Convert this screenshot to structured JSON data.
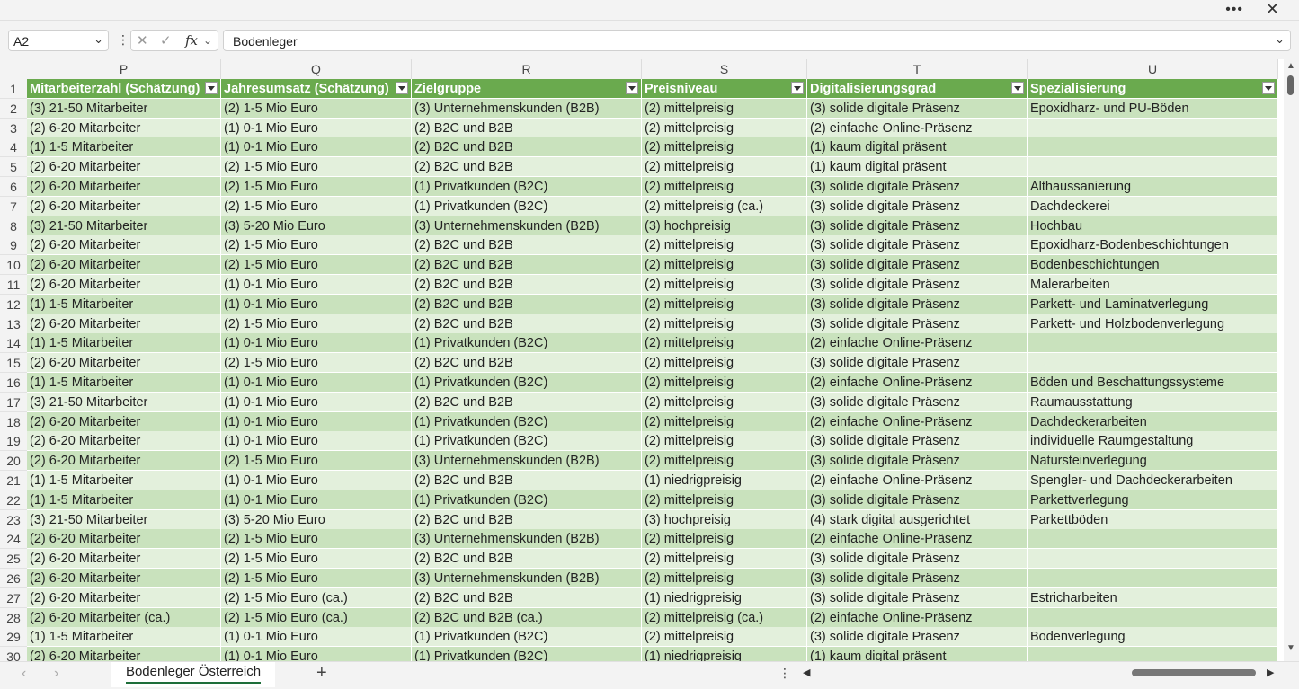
{
  "window": {
    "more_label": "•••",
    "close_label": "✕"
  },
  "formula_bar": {
    "name_box": "A2",
    "formula": "Bodenleger",
    "fx_label": "fx",
    "cancel_label": "✕",
    "enter_label": "✓"
  },
  "columns": [
    {
      "letter": "P",
      "header": "Mitarbeiterzahl (Schätzung)"
    },
    {
      "letter": "Q",
      "header": "Jahresumsatz (Schätzung)"
    },
    {
      "letter": "R",
      "header": "Zielgruppe"
    },
    {
      "letter": "S",
      "header": "Preisniveau"
    },
    {
      "letter": "T",
      "header": "Digitalisierungsgrad"
    },
    {
      "letter": "U",
      "header": "Spezialisierung"
    }
  ],
  "rows": [
    {
      "n": "2",
      "c": [
        "(3) 21-50 Mitarbeiter",
        "(2) 1-5 Mio Euro",
        "(3) Unternehmenskunden (B2B)",
        "(2) mittelpreisig",
        "(3) solide digitale Präsenz",
        "Epoxidharz- und PU-Böden"
      ]
    },
    {
      "n": "3",
      "c": [
        "(2) 6-20 Mitarbeiter",
        "(1) 0-1 Mio Euro",
        "(2) B2C und B2B",
        "(2) mittelpreisig",
        "(2) einfache Online-Präsenz",
        ""
      ]
    },
    {
      "n": "4",
      "c": [
        "(1) 1-5 Mitarbeiter",
        "(1) 0-1 Mio Euro",
        "(2) B2C und B2B",
        "(2) mittelpreisig",
        "(1) kaum digital präsent",
        ""
      ]
    },
    {
      "n": "5",
      "c": [
        "(2) 6-20 Mitarbeiter",
        "(2) 1-5 Mio Euro",
        "(2) B2C und B2B",
        "(2) mittelpreisig",
        "(1) kaum digital präsent",
        ""
      ]
    },
    {
      "n": "6",
      "c": [
        "(2) 6-20 Mitarbeiter",
        "(2) 1-5 Mio Euro",
        "(1) Privatkunden (B2C)",
        "(2) mittelpreisig",
        "(3) solide digitale Präsenz",
        "Althaussanierung"
      ]
    },
    {
      "n": "7",
      "c": [
        "(2) 6-20 Mitarbeiter",
        "(2) 1-5 Mio Euro",
        "(1) Privatkunden (B2C)",
        "(2) mittelpreisig (ca.)",
        "(3) solide digitale Präsenz",
        "Dachdeckerei"
      ]
    },
    {
      "n": "8",
      "c": [
        "(3) 21-50 Mitarbeiter",
        "(3) 5-20 Mio Euro",
        "(3) Unternehmenskunden (B2B)",
        "(3) hochpreisig",
        "(3) solide digitale Präsenz",
        "Hochbau"
      ]
    },
    {
      "n": "9",
      "c": [
        "(2) 6-20 Mitarbeiter",
        "(2) 1-5 Mio Euro",
        "(2) B2C und B2B",
        "(2) mittelpreisig",
        "(3) solide digitale Präsenz",
        "Epoxidharz-Bodenbeschichtungen"
      ]
    },
    {
      "n": "10",
      "c": [
        "(2) 6-20 Mitarbeiter",
        "(2) 1-5 Mio Euro",
        "(2) B2C und B2B",
        "(2) mittelpreisig",
        "(3) solide digitale Präsenz",
        "Bodenbeschichtungen"
      ]
    },
    {
      "n": "11",
      "c": [
        "(2) 6-20 Mitarbeiter",
        "(1) 0-1 Mio Euro",
        "(2) B2C und B2B",
        "(2) mittelpreisig",
        "(3) solide digitale Präsenz",
        "Malerarbeiten"
      ]
    },
    {
      "n": "12",
      "c": [
        "(1) 1-5 Mitarbeiter",
        "(1) 0-1 Mio Euro",
        "(2) B2C und B2B",
        "(2) mittelpreisig",
        "(3) solide digitale Präsenz",
        "Parkett- und Laminatverlegung"
      ]
    },
    {
      "n": "13",
      "c": [
        "(2) 6-20 Mitarbeiter",
        "(2) 1-5 Mio Euro",
        "(2) B2C und B2B",
        "(2) mittelpreisig",
        "(3) solide digitale Präsenz",
        "Parkett- und Holzbodenverlegung"
      ]
    },
    {
      "n": "14",
      "c": [
        "(1) 1-5 Mitarbeiter",
        "(1) 0-1 Mio Euro",
        "(1) Privatkunden (B2C)",
        "(2) mittelpreisig",
        "(2) einfache Online-Präsenz",
        ""
      ]
    },
    {
      "n": "15",
      "c": [
        "(2) 6-20 Mitarbeiter",
        "(2) 1-5 Mio Euro",
        "(2) B2C und B2B",
        "(2) mittelpreisig",
        "(3) solide digitale Präsenz",
        ""
      ]
    },
    {
      "n": "16",
      "c": [
        "(1) 1-5 Mitarbeiter",
        "(1) 0-1 Mio Euro",
        "(1) Privatkunden (B2C)",
        "(2) mittelpreisig",
        "(2) einfache Online-Präsenz",
        "Böden und Beschattungssysteme"
      ]
    },
    {
      "n": "17",
      "c": [
        "(3) 21-50 Mitarbeiter",
        "(1) 0-1 Mio Euro",
        "(2) B2C und B2B",
        "(2) mittelpreisig",
        "(3) solide digitale Präsenz",
        "Raumausstattung"
      ]
    },
    {
      "n": "18",
      "c": [
        "(2) 6-20 Mitarbeiter",
        "(1) 0-1 Mio Euro",
        "(1) Privatkunden (B2C)",
        "(2) mittelpreisig",
        "(2) einfache Online-Präsenz",
        "Dachdeckerarbeiten"
      ]
    },
    {
      "n": "19",
      "c": [
        "(2) 6-20 Mitarbeiter",
        "(1) 0-1 Mio Euro",
        "(1) Privatkunden (B2C)",
        "(2) mittelpreisig",
        "(3) solide digitale Präsenz",
        "individuelle Raumgestaltung"
      ]
    },
    {
      "n": "20",
      "c": [
        "(2) 6-20 Mitarbeiter",
        "(2) 1-5 Mio Euro",
        "(3) Unternehmenskunden (B2B)",
        "(2) mittelpreisig",
        "(3) solide digitale Präsenz",
        "Natursteinverlegung"
      ]
    },
    {
      "n": "21",
      "c": [
        "(1) 1-5 Mitarbeiter",
        "(1) 0-1 Mio Euro",
        "(2) B2C und B2B",
        "(1) niedrigpreisig",
        "(2) einfache Online-Präsenz",
        "Spengler- und Dachdeckerarbeiten"
      ]
    },
    {
      "n": "22",
      "c": [
        "(1) 1-5 Mitarbeiter",
        "(1) 0-1 Mio Euro",
        "(1) Privatkunden (B2C)",
        "(2) mittelpreisig",
        "(3) solide digitale Präsenz",
        "Parkettverlegung"
      ]
    },
    {
      "n": "23",
      "c": [
        "(3) 21-50 Mitarbeiter",
        "(3) 5-20 Mio Euro",
        "(2) B2C und B2B",
        "(3) hochpreisig",
        "(4) stark digital ausgerichtet",
        "Parkettböden"
      ]
    },
    {
      "n": "24",
      "c": [
        "(2) 6-20 Mitarbeiter",
        "(2) 1-5 Mio Euro",
        "(3) Unternehmenskunden (B2B)",
        "(2) mittelpreisig",
        "(2) einfache Online-Präsenz",
        ""
      ]
    },
    {
      "n": "25",
      "c": [
        "(2) 6-20 Mitarbeiter",
        "(2) 1-5 Mio Euro",
        "(2) B2C und B2B",
        "(2) mittelpreisig",
        "(3) solide digitale Präsenz",
        ""
      ]
    },
    {
      "n": "26",
      "c": [
        "(2) 6-20 Mitarbeiter",
        "(2) 1-5 Mio Euro",
        "(3) Unternehmenskunden (B2B)",
        "(2) mittelpreisig",
        "(3) solide digitale Präsenz",
        ""
      ]
    },
    {
      "n": "27",
      "c": [
        "(2) 6-20 Mitarbeiter",
        "(2) 1-5 Mio Euro (ca.)",
        "(2) B2C und B2B",
        "(1) niedrigpreisig",
        "(3) solide digitale Präsenz",
        "Estricharbeiten"
      ]
    },
    {
      "n": "28",
      "c": [
        "(2) 6-20 Mitarbeiter (ca.)",
        "(2) 1-5 Mio Euro (ca.)",
        "(2) B2C und B2B (ca.)",
        "(2) mittelpreisig (ca.)",
        "(2) einfache Online-Präsenz",
        ""
      ]
    },
    {
      "n": "29",
      "c": [
        "(1) 1-5 Mitarbeiter",
        "(1) 0-1 Mio Euro",
        "(1) Privatkunden (B2C)",
        "(2) mittelpreisig",
        "(3) solide digitale Präsenz",
        "Bodenverlegung"
      ]
    },
    {
      "n": "30",
      "c": [
        "(2) 6-20 Mitarbeiter",
        "(1) 0-1 Mio Euro",
        "(1) Privatkunden (B2C)",
        "(1) niedrigpreisig",
        "(1) kaum digital präsent",
        ""
      ]
    }
  ],
  "sheet_tabs": {
    "active": "Bodenleger Österreich",
    "add_label": "+"
  },
  "colors": {
    "header_green": "#6aaa4e",
    "band_dark": "#c9e2bd",
    "band_light": "#e3f0dc",
    "accent": "#1e6e3a"
  }
}
